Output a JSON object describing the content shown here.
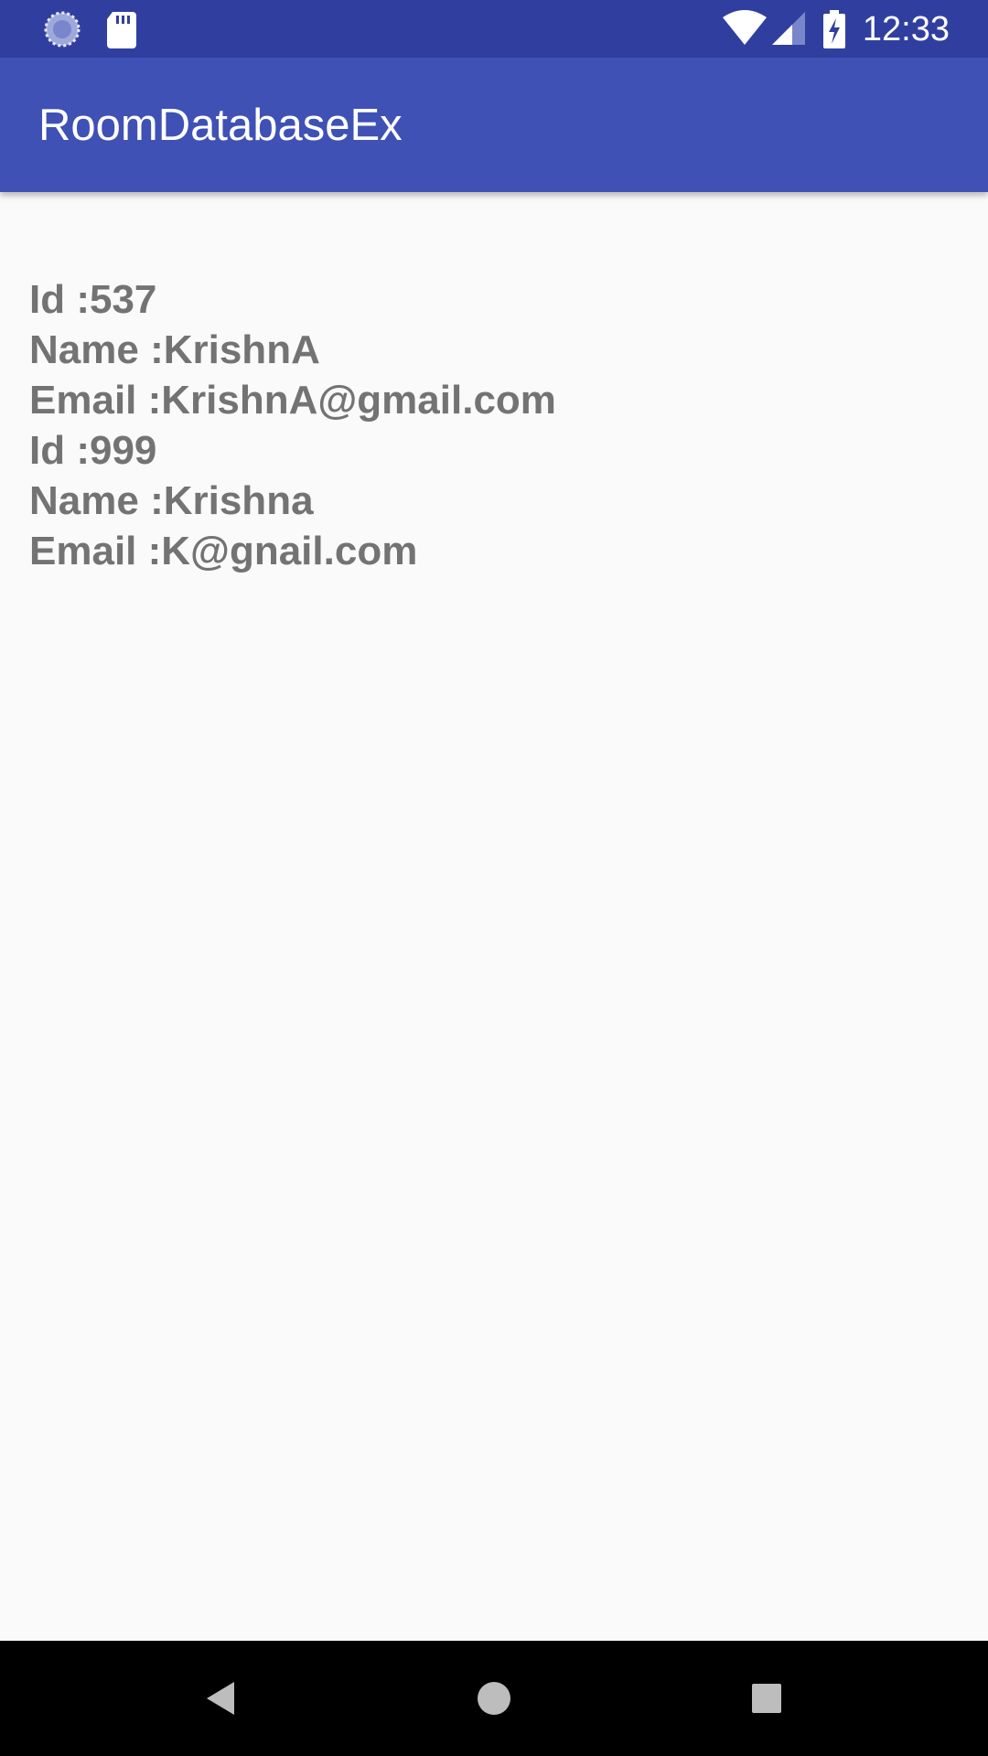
{
  "status_bar": {
    "time": "12:33",
    "left_icons": [
      "sync-icon",
      "sd-card-icon"
    ],
    "right_icons": [
      "wifi-icon",
      "cellular-signal-icon",
      "battery-charging-icon"
    ],
    "background_color": "#303f9f"
  },
  "app_bar": {
    "title": "RoomDatabaseEx",
    "background_color": "#3f51b5"
  },
  "records": [
    {
      "id_line": "Id :537",
      "name_line": "Name :KrishnA",
      "email_line": "Email :KrishnA@gmail.com"
    },
    {
      "id_line": "Id :999",
      "name_line": "Name :Krishna",
      "email_line": "Email :K@gnail.com"
    }
  ],
  "nav_bar": {
    "buttons": [
      "back-icon",
      "home-icon",
      "recents-icon"
    ]
  }
}
